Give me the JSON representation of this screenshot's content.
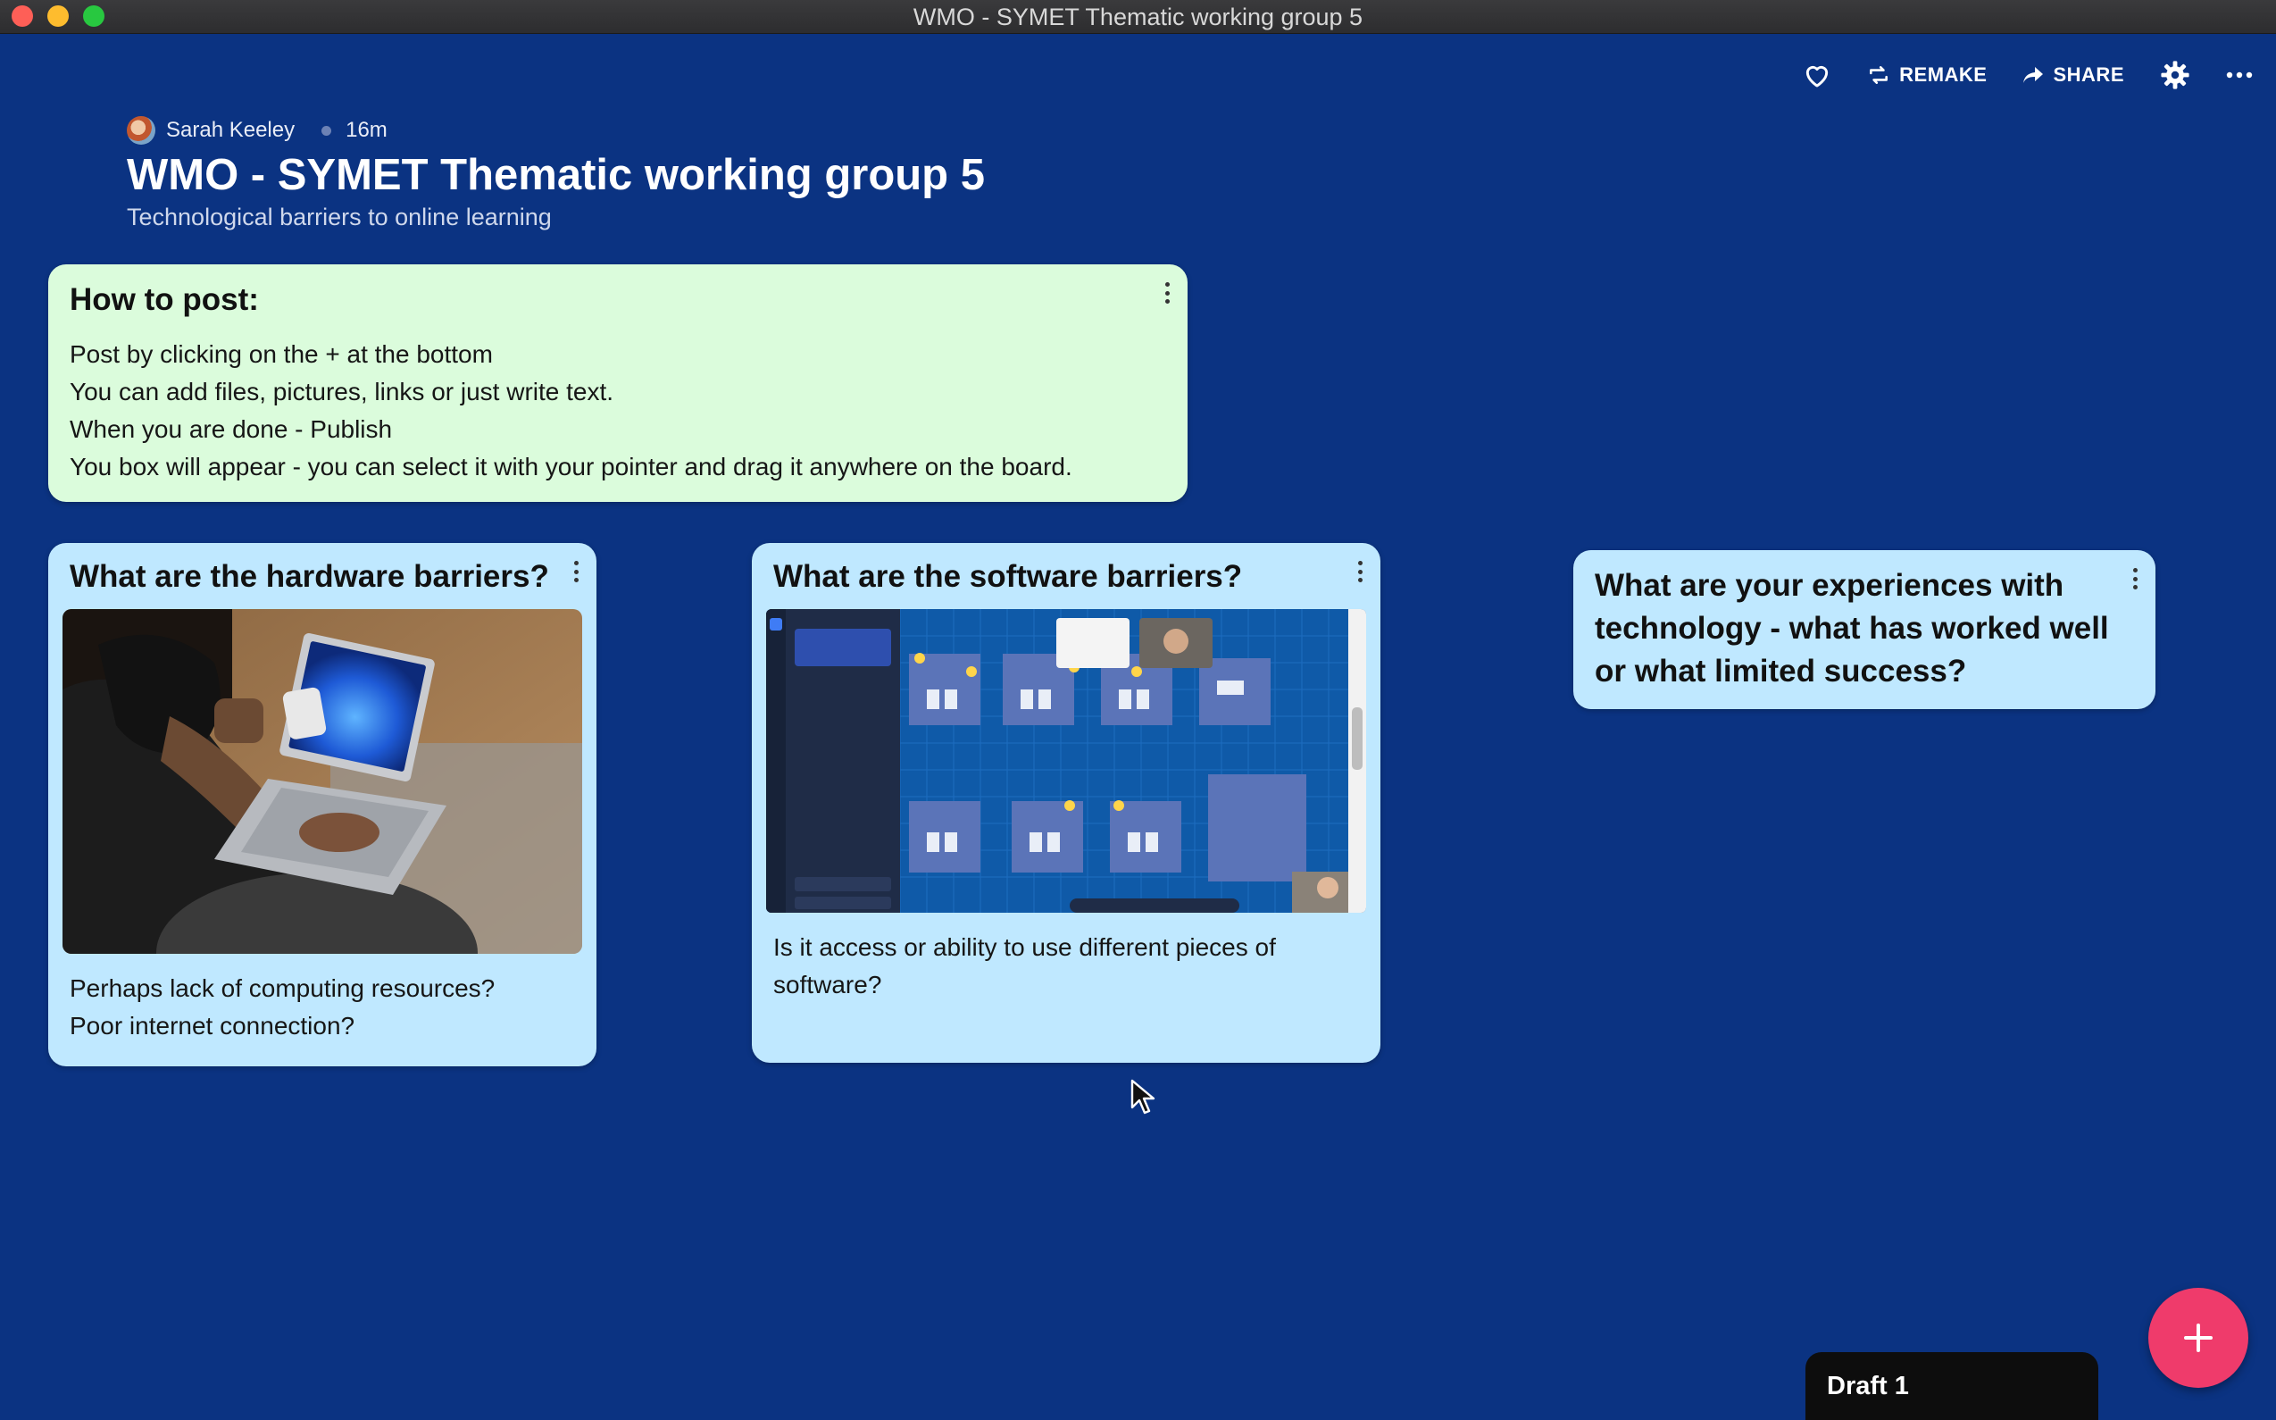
{
  "window": {
    "title": "WMO - SYMET Thematic working group 5"
  },
  "toolbar": {
    "remake_label": "REMAKE",
    "share_label": "SHARE"
  },
  "header": {
    "author": "Sarah Keeley",
    "time_ago": "16m",
    "title": "WMO - SYMET Thematic working group 5",
    "subtitle": "Technological barriers to online learning"
  },
  "cards": {
    "howto": {
      "title": "How to post:",
      "lines": [
        "Post by clicking on the + at the bottom",
        "You can add files, pictures, links or just write text.",
        "When you are done - Publish",
        "You box will appear - you can select it with your pointer and drag it anywhere on the board."
      ]
    },
    "hardware": {
      "title": "What are the hardware barriers?",
      "lines": [
        "Perhaps lack of computing resources?",
        "Poor internet connection?"
      ]
    },
    "software": {
      "title": "What are the software barriers?",
      "body": "Is it access or ability to use different pieces of software?"
    },
    "experience": {
      "title": "What are your experiences with technology - what has worked well or what limited success?"
    }
  },
  "draft": {
    "label": "Draft 1"
  },
  "colors": {
    "background": "#0b3382",
    "card_green": "#dbfcdc",
    "card_blue": "#bfe8ff",
    "fab": "#ef3b6b"
  }
}
